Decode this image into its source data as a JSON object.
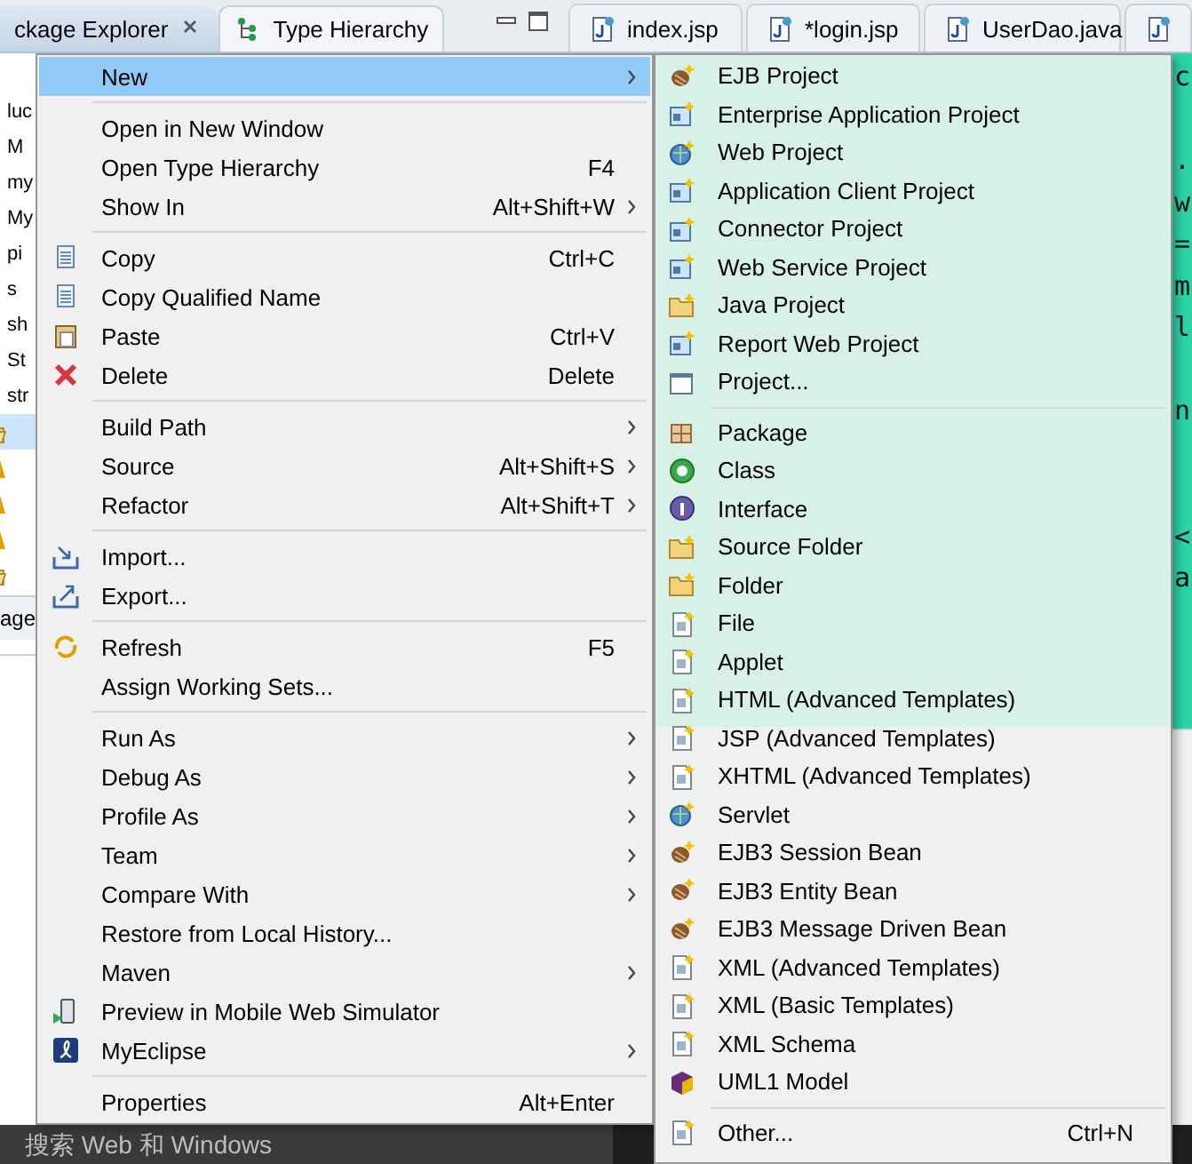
{
  "view_tabs": [
    {
      "label": "ckage Explorer",
      "selected": true,
      "closable": true
    },
    {
      "label": "Type Hierarchy",
      "selected": false,
      "closable": false
    }
  ],
  "editor_tabs": [
    {
      "label": "index.jsp",
      "selected": false
    },
    {
      "label": "*login.jsp",
      "selected": false
    },
    {
      "label": "UserDao.java",
      "selected": false
    },
    {
      "selected": false
    }
  ],
  "tree": {
    "items": [
      {
        "label": "luc",
        "kind": "project",
        "selected": false
      },
      {
        "label": "M",
        "kind": "project",
        "selected": false
      },
      {
        "label": "my",
        "kind": "project",
        "selected": false
      },
      {
        "label": "My",
        "kind": "project",
        "selected": false
      },
      {
        "label": "pi",
        "kind": "project",
        "selected": false
      },
      {
        "label": "s",
        "kind": "project",
        "selected": false
      },
      {
        "label": "sh",
        "kind": "project",
        "selected": false
      },
      {
        "label": "St",
        "kind": "project",
        "selected": false
      },
      {
        "label": "str",
        "kind": "project",
        "selected": false
      },
      {
        "kind": "folder",
        "selected": true
      },
      {
        "kind": "library",
        "selected": false
      },
      {
        "kind": "library",
        "selected": false
      },
      {
        "kind": "library",
        "selected": false
      },
      {
        "kind": "folder",
        "selected": false
      }
    ]
  },
  "lower_tab": {
    "label": "age"
  },
  "editor": {
    "lines": [
      "c",
      ".",
      "w",
      "=",
      "m",
      "l",
      "n",
      "<",
      "a"
    ]
  },
  "context_menu": {
    "groups": [
      {
        "items": [
          {
            "label": "New",
            "submenu": true,
            "selected": true
          }
        ]
      },
      {
        "items": [
          {
            "label": "Open in New Window",
            "submenu": false,
            "selected": false
          },
          {
            "label": "Open Type Hierarchy",
            "shortcut": "F4",
            "submenu": false,
            "selected": false
          },
          {
            "label": "Show In",
            "shortcut": "Alt+Shift+W",
            "submenu": true,
            "selected": false
          }
        ]
      },
      {
        "items": [
          {
            "label": "Copy",
            "shortcut": "Ctrl+C",
            "submenu": false,
            "selected": false
          },
          {
            "label": "Copy Qualified Name",
            "submenu": false,
            "selected": false
          },
          {
            "label": "Paste",
            "shortcut": "Ctrl+V",
            "submenu": false,
            "selected": false
          },
          {
            "label": "Delete",
            "shortcut": "Delete",
            "submenu": false,
            "selected": false
          }
        ]
      },
      {
        "items": [
          {
            "label": "Build Path",
            "submenu": true,
            "selected": false
          },
          {
            "label": "Source",
            "shortcut": "Alt+Shift+S",
            "submenu": true,
            "selected": false
          },
          {
            "label": "Refactor",
            "shortcut": "Alt+Shift+T",
            "submenu": true,
            "selected": false
          }
        ]
      },
      {
        "items": [
          {
            "label": "Import...",
            "submenu": false,
            "selected": false
          },
          {
            "label": "Export...",
            "submenu": false,
            "selected": false
          }
        ]
      },
      {
        "items": [
          {
            "label": "Refresh",
            "shortcut": "F5",
            "submenu": false,
            "selected": false
          },
          {
            "label": "Assign Working Sets...",
            "submenu": false,
            "selected": false
          }
        ]
      },
      {
        "items": [
          {
            "label": "Run As",
            "submenu": true,
            "selected": false
          },
          {
            "label": "Debug As",
            "submenu": true,
            "selected": false
          },
          {
            "label": "Profile As",
            "submenu": true,
            "selected": false
          },
          {
            "label": "Team",
            "submenu": true,
            "selected": false
          },
          {
            "label": "Compare With",
            "submenu": true,
            "selected": false
          },
          {
            "label": "Restore from Local History...",
            "submenu": false,
            "selected": false
          },
          {
            "label": "Maven",
            "submenu": true,
            "selected": false
          },
          {
            "label": "Preview in Mobile Web Simulator",
            "submenu": false,
            "selected": false
          },
          {
            "label": "MyEclipse",
            "submenu": true,
            "selected": false
          }
        ]
      },
      {
        "items": [
          {
            "label": "Properties",
            "shortcut": "Alt+Enter",
            "submenu": false,
            "selected": false
          }
        ]
      }
    ]
  },
  "new_submenu": {
    "groups": [
      {
        "items": [
          {
            "label": "EJB Project",
            "selected": false
          },
          {
            "label": "Enterprise Application Project",
            "selected": false
          },
          {
            "label": "Web Project",
            "selected": false
          },
          {
            "label": "Application Client Project",
            "selected": false
          },
          {
            "label": "Connector Project",
            "selected": false
          },
          {
            "label": "Web Service Project",
            "selected": false
          },
          {
            "label": "Java Project",
            "selected": false
          },
          {
            "label": "Report Web Project",
            "selected": false
          },
          {
            "label": "Project...",
            "selected": false
          }
        ]
      },
      {
        "items": [
          {
            "label": "Package",
            "selected": false
          },
          {
            "label": "Class",
            "selected": false
          },
          {
            "label": "Interface",
            "selected": false
          },
          {
            "label": "Source Folder",
            "selected": false
          },
          {
            "label": "Folder",
            "selected": false
          },
          {
            "label": "File",
            "selected": false
          },
          {
            "label": "Applet",
            "selected": false
          },
          {
            "label": "HTML (Advanced Templates)",
            "selected": false
          },
          {
            "label": "JSP (Advanced Templates)",
            "selected": false
          },
          {
            "label": "XHTML (Advanced Templates)",
            "selected": false
          },
          {
            "label": "Servlet",
            "selected": false
          },
          {
            "label": "EJB3 Session Bean",
            "selected": false
          },
          {
            "label": "EJB3 Entity Bean",
            "selected": false
          },
          {
            "label": "EJB3 Message Driven Bean",
            "selected": false
          },
          {
            "label": "XML (Advanced Templates)",
            "selected": false
          },
          {
            "label": "XML (Basic Templates)",
            "selected": false
          },
          {
            "label": "XML Schema",
            "selected": false
          },
          {
            "label": "UML1 Model",
            "selected": false
          }
        ]
      },
      {
        "items": [
          {
            "label": "Other...",
            "shortcut": "Ctrl+N",
            "selected": false
          }
        ]
      }
    ]
  },
  "taskbar": {
    "search": {
      "placeholder": "搜索 Web 和 Windows"
    }
  }
}
